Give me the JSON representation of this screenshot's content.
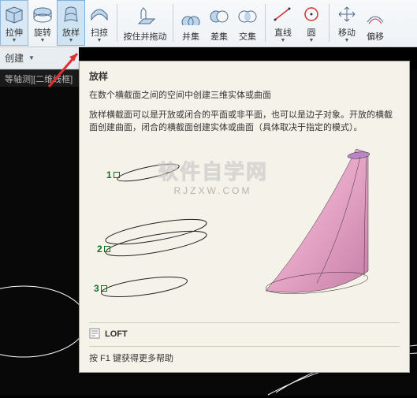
{
  "ribbon": {
    "extrude": "拉伸",
    "revolve": "旋转",
    "loft": "放样",
    "sweep": "扫掠",
    "presspull": "按住并拖动",
    "union": "并集",
    "subtract": "差集",
    "intersect": "交集",
    "line": "直线",
    "circle": "圆",
    "move": "移动",
    "offset": "偏移"
  },
  "subbar": {
    "create": "创建"
  },
  "tabs": {
    "view": "等轴测][二维线框]"
  },
  "tooltip": {
    "title": "放样",
    "desc1": "在数个横截面之间的空间中创建三维实体或曲面",
    "desc2": "放样横截面可以是开放或闭合的平面或非平面，也可以是边子对象。开放的横截面创建曲面，闭合的横截面创建实体或曲面（具体取决于指定的模式）。",
    "n1": "1",
    "n2": "2",
    "n3": "3",
    "cmd_icon": "📄",
    "cmd": "LOFT",
    "help": "按 F1 键获得更多帮助"
  },
  "watermark": {
    "top": "软件自学网",
    "bot": "RJZXW.COM"
  }
}
